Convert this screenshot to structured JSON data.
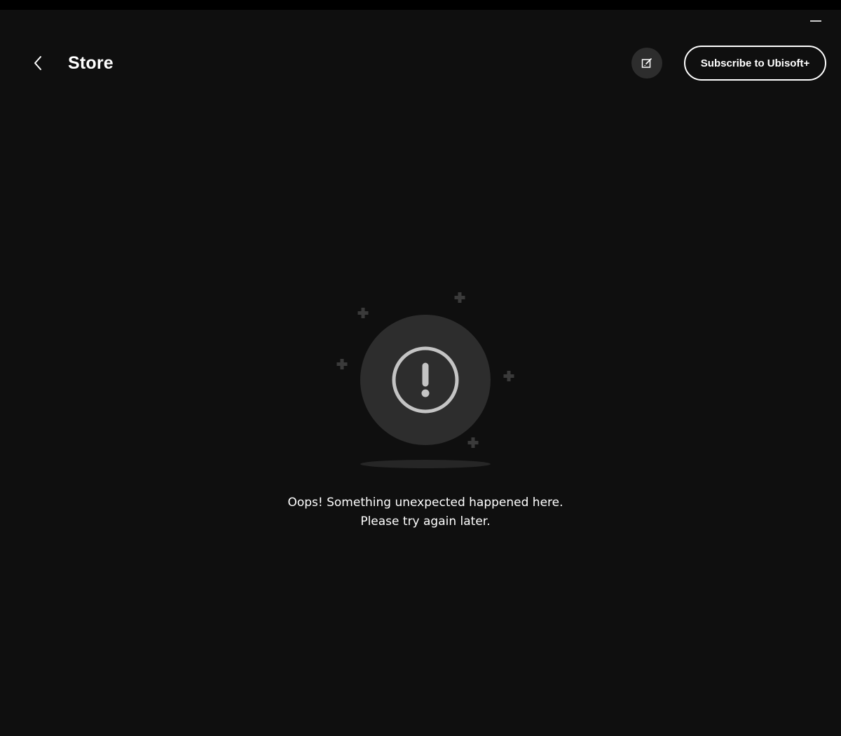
{
  "window": {
    "minimize_icon": "minimize-icon"
  },
  "header": {
    "back_icon": "chevron-left-icon",
    "title": "Store",
    "feedback_icon": "feedback-edit-icon",
    "subscribe_label": "Subscribe to Ubisoft+"
  },
  "error": {
    "icon": "exclamation-circle-icon",
    "decoration_icon": "sparkle-plus-icon",
    "line1": "Oops! Something unexpected happened here.",
    "line2": "Please try again later."
  },
  "colors": {
    "background": "#0f0f0f",
    "circle": "#2d2d2d",
    "sparkle": "#3a3a3a",
    "icon_stroke": "#c4c4c4",
    "text": "#ffffff"
  }
}
